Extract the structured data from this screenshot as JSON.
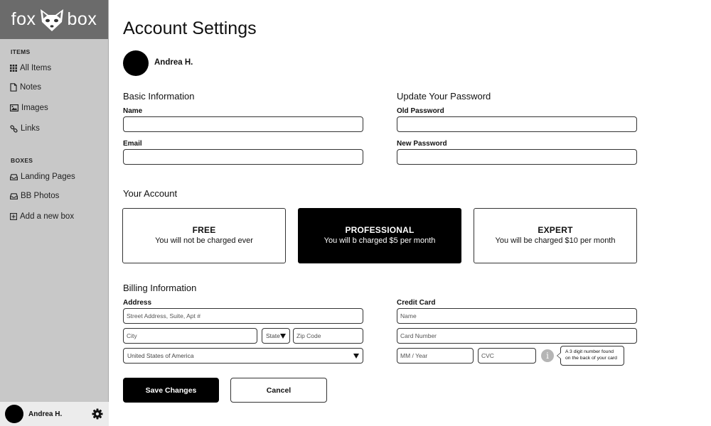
{
  "app": {
    "logo_left": "fox",
    "logo_right": "box"
  },
  "sidebar": {
    "items_title": "ITEMS",
    "items": [
      {
        "label": "All Items",
        "icon": "grid-icon"
      },
      {
        "label": "Notes",
        "icon": "note-icon"
      },
      {
        "label": "Images",
        "icon": "image-icon"
      },
      {
        "label": "Links",
        "icon": "link-icon"
      }
    ],
    "boxes_title": "BOXES",
    "boxes": [
      {
        "label": "Landing Pages",
        "icon": "inbox-icon"
      },
      {
        "label": "BB Photos",
        "icon": "inbox-icon"
      },
      {
        "label": "Add a new box",
        "icon": "plus-square-icon"
      }
    ],
    "user_name": "Andrea H."
  },
  "page": {
    "title": "Account Settings",
    "profile_name": "Andrea H."
  },
  "basic_info": {
    "heading": "Basic Information",
    "name_label": "Name",
    "name_value": "",
    "email_label": "Email",
    "email_value": ""
  },
  "password": {
    "heading": "Update Your Password",
    "old_label": "Old Password",
    "new_label": "New Password"
  },
  "account": {
    "heading": "Your Account",
    "selected": "PROFESSIONAL",
    "plans": [
      {
        "name": "FREE",
        "desc": "You will not be charged ever"
      },
      {
        "name": "PROFESSIONAL",
        "desc": "You will b charged $5 per month"
      },
      {
        "name": "EXPERT",
        "desc": "You will be charged $10 per month"
      }
    ]
  },
  "billing": {
    "heading": "Billing Information",
    "address_label": "Address",
    "street_placeholder": "Street Address, Suite, Apt #",
    "city_placeholder": "City",
    "state_value": "State",
    "zip_placeholder": "Zip Code",
    "country_value": "United States of America",
    "card_label": "Credit Card",
    "card_name_placeholder": "Name",
    "card_number_placeholder": "Card Number",
    "expiry_placeholder": "MM / Year",
    "cvc_placeholder": "CVC",
    "cvc_tooltip_line1": "A 3 digit number found",
    "cvc_tooltip_line2": "on the back of your card",
    "info_glyph": "i"
  },
  "actions": {
    "save_label": "Save Changes",
    "cancel_label": "Cancel"
  },
  "colors": {
    "sidebar_bg": "#c8c8c8",
    "logo_bg": "#6b6b6b",
    "selected_plan_bg": "#000000",
    "primary_button": "#000000"
  }
}
